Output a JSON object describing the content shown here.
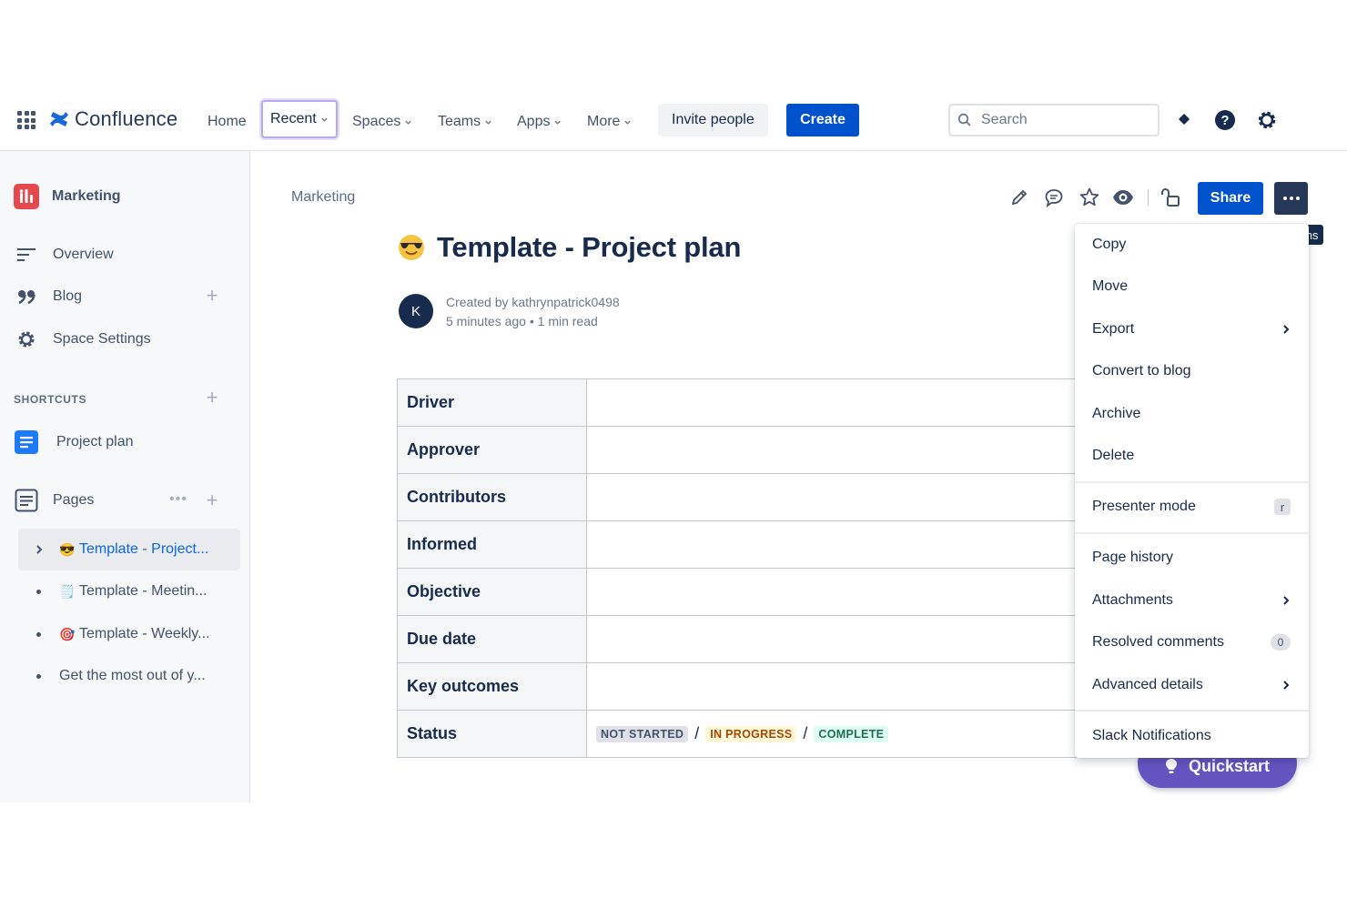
{
  "app": {
    "name": "Confluence"
  },
  "topnav": {
    "home": "Home",
    "recent": "Recent",
    "spaces": "Spaces",
    "teams": "Teams",
    "apps": "Apps",
    "more": "More",
    "invite": "Invite people",
    "create": "Create",
    "search_placeholder": "Search",
    "icons": [
      "app-switcher-icon",
      "notifications-icon",
      "help-icon",
      "settings-icon"
    ]
  },
  "sidebar": {
    "space_name": "Marketing",
    "items": [
      {
        "label": "Overview",
        "icon": "overview-icon"
      },
      {
        "label": "Blog",
        "icon": "quote-icon"
      },
      {
        "label": "Space Settings",
        "icon": "gear-icon"
      }
    ],
    "shortcuts_label": "SHORTCUTS",
    "shortcut": "Project plan",
    "pages_label": "Pages",
    "tree": [
      {
        "label": "Template - Project...",
        "emoji": "😎",
        "selected": true
      },
      {
        "label": "Template - Meetin...",
        "emoji": "🗒️"
      },
      {
        "label": "Template - Weekly...",
        "emoji": "🎯"
      },
      {
        "label": "Get the most out of y..."
      }
    ]
  },
  "page": {
    "breadcrumb": "Marketing",
    "title": "Template - Project plan",
    "author_initial": "K",
    "created_by": "Created by kathrynpatrick0498",
    "age": "5 minutes ago",
    "read_time": "1 min read",
    "share": "Share",
    "more_tooltip": "More actions",
    "properties": [
      {
        "key": "Driver"
      },
      {
        "key": "Approver"
      },
      {
        "key": "Contributors"
      },
      {
        "key": "Informed"
      },
      {
        "key": "Objective"
      },
      {
        "key": "Due date"
      },
      {
        "key": "Key outcomes"
      },
      {
        "key": "Status"
      }
    ],
    "status_lozenges": [
      {
        "text": "NOT STARTED",
        "color": "#dfe1e6"
      },
      {
        "text": "IN PROGRESS",
        "color": "#fff7d6"
      },
      {
        "text": "COMPLETE",
        "color": "#dcfff1"
      }
    ]
  },
  "menu": {
    "items": [
      {
        "label": "Copy"
      },
      {
        "label": "Move"
      },
      {
        "label": "Export",
        "submenu": true
      },
      {
        "label": "Convert to blog"
      },
      {
        "label": "Archive"
      },
      {
        "label": "Delete"
      },
      {
        "label": "Presenter mode",
        "shortcut": "r"
      },
      {
        "label": "Page history"
      },
      {
        "label": "Attachments",
        "submenu": true
      },
      {
        "label": "Resolved comments",
        "count": "0"
      },
      {
        "label": "Advanced details",
        "submenu": true
      },
      {
        "label": "Slack Notifications"
      }
    ]
  },
  "quickstart": "Quickstart",
  "colors": {
    "primary": "#0052cc",
    "nav_dark": "#253858",
    "quickstart": "#6554c0",
    "space_avatar": "#e5484d"
  }
}
